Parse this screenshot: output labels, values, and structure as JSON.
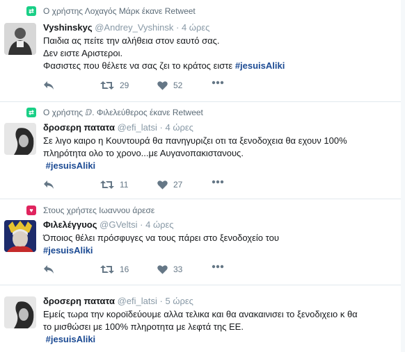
{
  "tweets": [
    {
      "context": "Ο χρήστης Λοχαγός Μάρκ έκανε Retweet",
      "context_type": "retweet",
      "name": "Vyshinskyς",
      "handle": "@Andrey_Vyshinsk",
      "time": "4 ώρες",
      "lines": [
        "Παιδια ας πείτε την αλήθεια στον εαυτό σας.",
        "Δεν ειστε Αριστεροι."
      ],
      "last_line": "Φασιστες που θέλετε να σας ζει το κράτος ειστε ",
      "hashtag": "#jesuisAliki",
      "retweets": "29",
      "likes": "52"
    },
    {
      "context": "Ο χρήστης ⅅ. Φιλελεύθερος έκανε Retweet",
      "context_type": "retweet",
      "name": "δροσερη πατατα",
      "handle": "@efi_latsi",
      "time": "4 ώρες",
      "lines": [
        "Σε λιγο καιρο η Κουντουρά θα πανηγυριζει οτι τα ξενοδοχεια θα εχουν 100%",
        "πληρότητα ολο το χρονο...με Αυγανοπακιστανους."
      ],
      "last_line": "",
      "hashtag": "#jesuisAliki",
      "retweets": "11",
      "likes": "27"
    },
    {
      "context": "Στους χρήστες Ιωαννου άρεσε",
      "context_type": "like",
      "name": "Φιλελέγγυος",
      "handle": "@GVeltsi",
      "time": "4 ώρες",
      "lines": [
        "Όποιος θέλει πρόσφυγες να τους πάρει στο ξενοδοχείο του"
      ],
      "last_line": "",
      "hashtag": "#jesuisAliki",
      "retweets": "16",
      "likes": "33"
    },
    {
      "context": "",
      "context_type": "none",
      "name": "δροσερη πατατα",
      "handle": "@efi_latsi",
      "time": "5 ώρες",
      "lines": [
        "Εμείς τωρα την κοροϊδεύουμε αλλα τελικα και θα ανακαινισει το ξενοδιχειο κ θα",
        "το μισθώσει με 100% πληροτητα με λεφτά της ΕΕ."
      ],
      "last_line": "",
      "hashtag": "#jesuisAliki",
      "retweets": "",
      "likes": ""
    }
  ],
  "colors": {
    "retweet_icon": "#19cf86",
    "like_icon": "#e0245e",
    "hashtag": "#1b4a93",
    "action": "#657786"
  },
  "icons": {
    "reply": "reply-icon",
    "retweet": "retweet-icon",
    "like": "heart-icon",
    "more": "more-icon"
  }
}
